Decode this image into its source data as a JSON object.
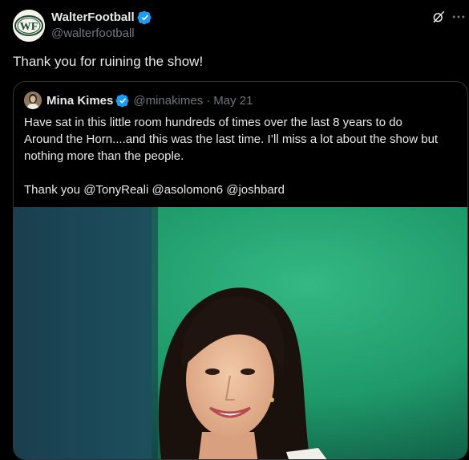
{
  "tweet": {
    "display_name": "WalterFootball",
    "handle": "@walterfootball",
    "text": "Thank you for ruining the show!",
    "avatar_icon": "wf-logo-icon"
  },
  "quoted": {
    "display_name": "Mina Kimes",
    "handle": "@minakimes",
    "separator": "·",
    "date": "May 21",
    "lines": [
      "Have sat in this little room hundreds of times over the last 8 years to do",
      "Around the Horn....and this was the last time. I’ll miss a lot about the show but",
      "nothing more than the people."
    ],
    "thanks_line": "Thank you @TonyReali @asolomon6 @joshbard"
  },
  "colors": {
    "background": "#000000",
    "text": "#e7e9ea",
    "muted": "#71767b",
    "verified": "#1d9bf0",
    "border": "#2f3336",
    "media_green": "#1f9a6a",
    "media_teal": "#1c4f5c"
  },
  "logo": {
    "text": "WF"
  }
}
